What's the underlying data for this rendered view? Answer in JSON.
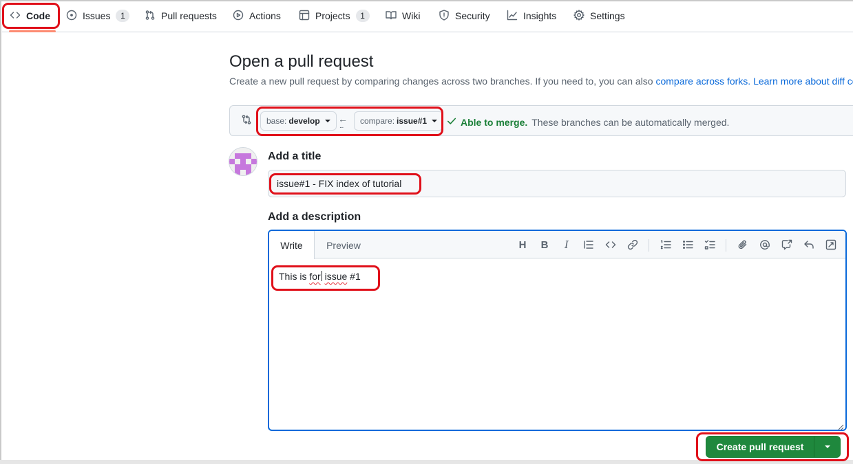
{
  "nav": {
    "code": "Code",
    "issues": "Issues",
    "issues_count": "1",
    "pull_requests": "Pull requests",
    "actions": "Actions",
    "projects": "Projects",
    "projects_count": "1",
    "wiki": "Wiki",
    "security": "Security",
    "insights": "Insights",
    "settings": "Settings"
  },
  "header": {
    "title": "Open a pull request",
    "subtitle": "Create a new pull request by comparing changes across two branches. If you need to, you can also ",
    "link_forks": "compare across forks.",
    "link_diff": "Learn more about diff comparisons here."
  },
  "compare": {
    "base_prefix": "base:",
    "base_branch": "develop",
    "compare_prefix": "compare:",
    "compare_branch": "issue#1",
    "merge_ok": "Able to merge.",
    "merge_text": "These branches can be automatically merged."
  },
  "form": {
    "title_label": "Add a title",
    "title_value": "issue#1 - FIX index of tutorial",
    "description_label": "Add a description",
    "tab_write": "Write",
    "tab_preview": "Preview",
    "body_part1": "This is ",
    "body_part2": "for",
    "body_part3": " ",
    "body_part4": "issue",
    "body_part5": " #1"
  },
  "toolbar": {
    "heading": "H",
    "bold": "B",
    "italic": "I"
  },
  "actions": {
    "create_label": "Create pull request"
  },
  "colors": {
    "accent": "#0969da",
    "primary_button": "#1f883d",
    "annotation": "#e0101a",
    "nav_underline": "#fd8c73"
  }
}
